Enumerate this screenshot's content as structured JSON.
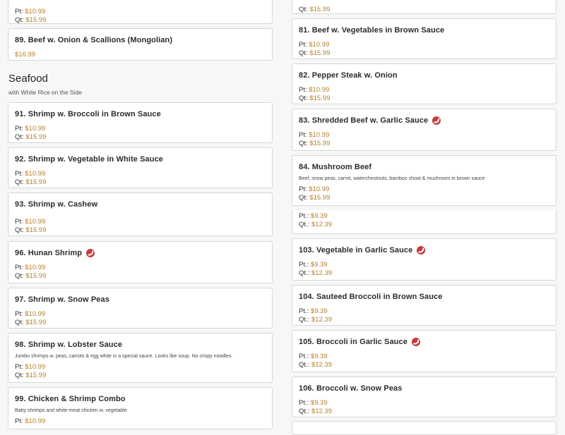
{
  "left": {
    "top_card": {
      "pt_label": "Pt:",
      "pt": "$10.99",
      "qt_label": "Qt:",
      "qt": "$15.99"
    },
    "beef_89": {
      "title": "89. Beef w. Onion & Scallions (Mongolian)",
      "price": "$16.99"
    },
    "section": {
      "title": "Seafood",
      "subtitle": "with White Rice on the Side"
    },
    "items": [
      {
        "title": "91. Shrimp w. Broccoli in Brown Sauce",
        "pt_label": "Pt:",
        "pt": "$10.99",
        "qt_label": "Qt:",
        "qt": "$15.99"
      },
      {
        "title": "92. Shrimp w. Vegetable in White Sauce",
        "pt_label": "Pt:",
        "pt": "$10.99",
        "qt_label": "Qt:",
        "qt": "$15.99"
      },
      {
        "title": "93. Shrimp w. Cashew",
        "pt_label": "Pt:",
        "pt": "$10.99",
        "qt_label": "Qt:",
        "qt": "$15.99"
      },
      {
        "title": "96. Hunan Shrimp",
        "pt_label": "Pt:",
        "pt": "$10.99",
        "qt_label": "Qt:",
        "qt": "$15.99"
      },
      {
        "title": "97. Shrimp w. Snow Peas",
        "pt_label": "Pt:",
        "pt": "$10.99",
        "qt_label": "Qt:",
        "qt": "$15.99"
      },
      {
        "title": "98. Shrimp w. Lobster Sauce",
        "desc": "Jumbo shrimps w. peas, carrots & egg white in a special sauce. Looks like soup. No crispy noodles.",
        "pt_label": "Pt:",
        "pt": "$10.99",
        "qt_label": "Qt:",
        "qt": "$15.99"
      },
      {
        "title": "99. Chicken & Shrimp Combo",
        "desc": "Baby shrimps and white-meat chicken w. vegetable",
        "pt_label": "Pt:",
        "pt": "$10.99"
      }
    ]
  },
  "right": {
    "top_card": {
      "qt_label": "Qt:",
      "qt": "$15.99"
    },
    "items": [
      {
        "title": "81. Beef w. Vegetables in Brown Sauce",
        "pt_label": "Pt:",
        "pt": "$10.99",
        "qt_label": "Qt:",
        "qt": "$15.99"
      },
      {
        "title": "82. Pepper Steak w. Onion",
        "pt_label": "Pt:",
        "pt": "$10.99",
        "qt_label": "Qt:",
        "qt": "$15.99"
      },
      {
        "title": "83. Shredded Beef w. Garlic Sauce",
        "pt_label": "Pt:",
        "pt": "$10.99",
        "qt_label": "Qt:",
        "qt": "$15.99"
      },
      {
        "title": "84. Mushroom Beef",
        "desc": "Beef, snow peas, carrot, waterchestnuts, bamboo shoot & mushroom in brown sauce",
        "pt_label": "Pt:",
        "pt": "$10.99",
        "qt_label": "Qt:",
        "qt": "$15.99"
      }
    ],
    "partial": {
      "pt_label": "Pt.:",
      "pt": "$9.39",
      "qt_label": "Qt.:",
      "qt": "$12.39"
    },
    "veg_items": [
      {
        "title": "103. Vegetable in Garlic Sauce",
        "pt_label": "Pt.:",
        "pt": "$9.39",
        "qt_label": "Qt.:",
        "qt": "$12.39"
      },
      {
        "title": "104. Sauteed Broccoli in Brown Sauce",
        "pt_label": "Pt.:",
        "pt": "$9.39",
        "qt_label": "Qt.:",
        "qt": "$12.39"
      },
      {
        "title": "105. Broccoli in Garlic Sauce",
        "pt_label": "Pt.:",
        "pt": "$9.39",
        "qt_label": "Qt.:",
        "qt": "$12.39"
      },
      {
        "title": "106. Broccoli w. Snow Peas",
        "pt_label": "Pt.:",
        "pt": "$9.39",
        "qt_label": "Qt.:",
        "qt": "$12.39"
      }
    ]
  },
  "icons": {
    "spicy": "spicy-pepper-icon"
  },
  "colors": {
    "price": "#b5812a",
    "spicy": "#c83b3b"
  }
}
